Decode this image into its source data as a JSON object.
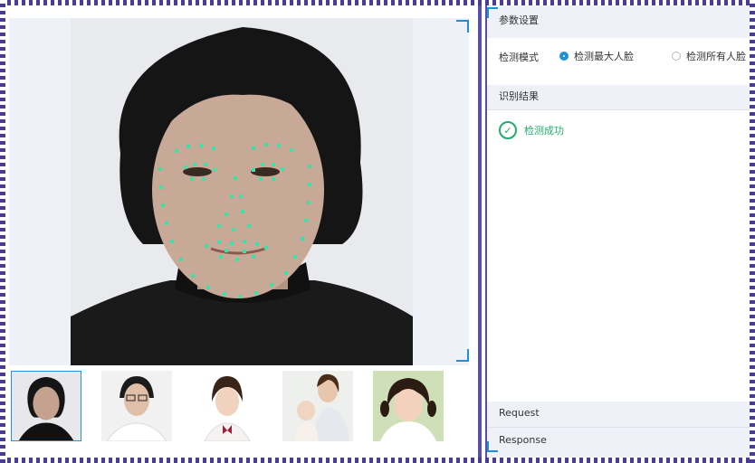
{
  "settings": {
    "title": "参数设置",
    "mode_label": "检测模式",
    "options": [
      "检测最大人脸",
      "检测所有人脸"
    ],
    "selected_index": 0
  },
  "result": {
    "title": "识别结果",
    "status": "检测成功"
  },
  "footer": {
    "request": "Request",
    "response": "Response"
  },
  "thumbnails": [
    {
      "name": "man-long-hair"
    },
    {
      "name": "woman-glasses"
    },
    {
      "name": "girl-bow"
    },
    {
      "name": "mother-baby"
    },
    {
      "name": "child-smiling"
    }
  ],
  "colors": {
    "accent": "#1e90d8",
    "success": "#1fae6d",
    "landmark": "#3fe0a6"
  }
}
